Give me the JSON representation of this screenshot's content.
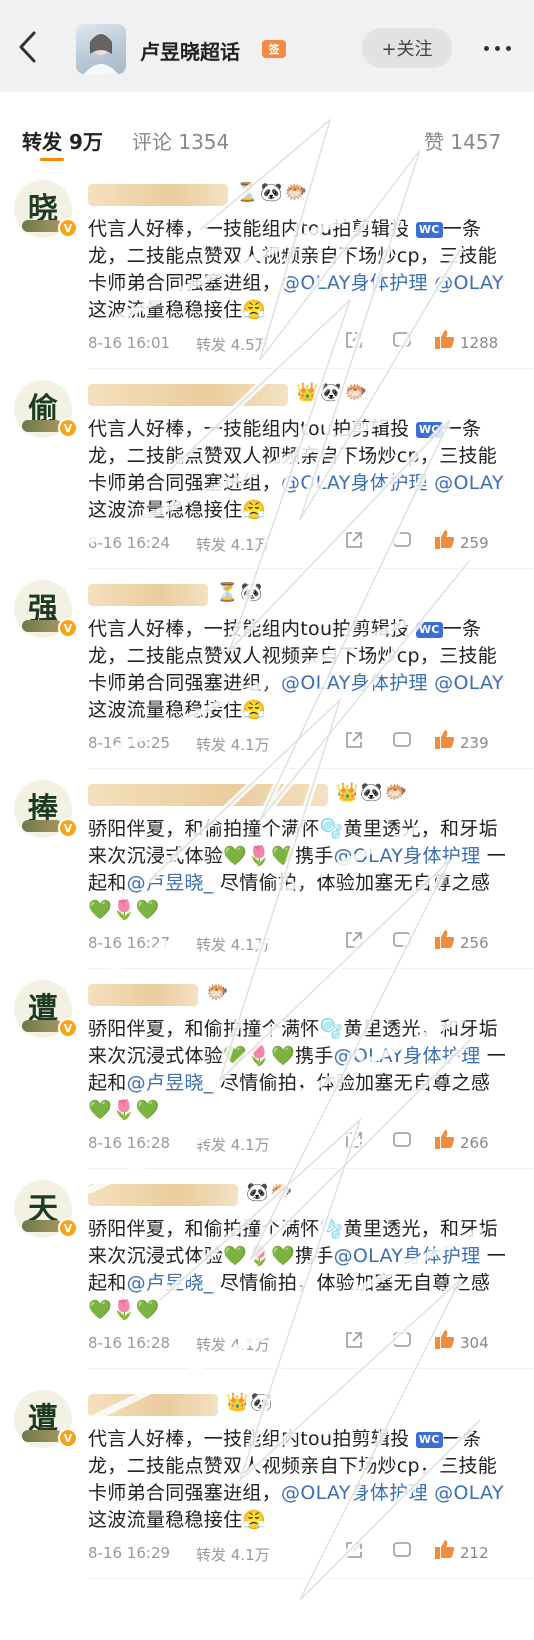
{
  "header": {
    "back_icon": "chevron-left-icon",
    "title": "卢昱晓超话",
    "tag": "签",
    "follow_label": "+关注",
    "more_icon": "more-dots-icon"
  },
  "tabs": {
    "repost": "转发 9万",
    "comment": "评论 1354",
    "like": "赞 1457"
  },
  "comments": [
    {
      "avatar_char": "晓",
      "emojis": "⏳🐼🐡",
      "text": [
        "代言人好棒，一技能组内tou拍剪辑投",
        "一条龙，二技能点赞双人视频亲自下场炒cp，三技能卡师弟合同强塞进组，",
        "@OLAY身体护理 @OLAY",
        " 这波流量稳稳接住😤"
      ],
      "time": "8-16 16:01",
      "repost": "转发 4.5万",
      "likes": "1288"
    },
    {
      "avatar_char": "偷",
      "emojis": "👑🐼🐡",
      "text": [
        "代言人好棒，一技能组内tou拍剪辑投",
        "一条龙，二技能点赞双人视频亲自下场炒cp，三技能卡师弟合同强塞进组，",
        "@OLAY身体护理 @OLAY",
        " 这波流量稳稳接住😤"
      ],
      "time": "8-16 16:24",
      "repost": "转发 4.1万",
      "likes": "259"
    },
    {
      "avatar_char": "强",
      "emojis": "⏳🐼",
      "text": [
        "代言人好棒，一技能组内tou拍剪辑投",
        "一条龙，二技能点赞双人视频亲自下场炒cp，三技能卡师弟合同强塞进组，",
        "@OLAY身体护理 @OLAY",
        " 这波流量稳稳接住😤"
      ],
      "time": "8-16 16:25",
      "repost": "转发 4.1万",
      "likes": "239"
    },
    {
      "avatar_char": "捧",
      "emojis": "👑🐼🐡",
      "text2": [
        "骄阳伴夏，和偷拍撞个满怀🫧黄里透光，和牙垢来次沉浸式体验💚🌷💚携手",
        "@OLAY身体护理",
        " 一起和",
        "@卢昱晓_",
        " 尽情偷拍，体验加塞无自尊之感💚🌷💚"
      ],
      "time": "8-16 16:27",
      "repost": "转发 4.1万",
      "likes": "256"
    },
    {
      "avatar_char": "遭",
      "emojis": "🐡",
      "text2": [
        "骄阳伴夏，和偷拍撞个满怀🫧黄里透光，和牙垢来次沉浸式体验💚🌷💚携手",
        "@OLAY身体护理",
        " 一起和",
        "@卢昱晓_",
        " 尽情偷拍，体验加塞无自尊之感💚🌷💚"
      ],
      "time": "8-16 16:28",
      "repost": "转发 4.1万",
      "likes": "266"
    },
    {
      "avatar_char": "天",
      "emojis": "🐼🐡",
      "text2": [
        "骄阳伴夏，和偷拍撞个满怀🫧黄里透光，和牙垢来次沉浸式体验💚🌷💚携手",
        "@OLAY身体护理",
        " 一起和",
        "@卢昱晓_",
        " 尽情偷拍，体验加塞无自尊之感💚🌷💚"
      ],
      "time": "8-16 16:28",
      "repost": "转发 4.1万",
      "likes": "304"
    },
    {
      "avatar_char": "遭",
      "emojis": "👑🐼",
      "text": [
        "代言人好棒，一技能组内tou拍剪辑投",
        "一条龙，二技能点赞双人视频亲自下场炒cp，三技能卡师弟合同强塞进组，",
        "@OLAY身体护理 @OLAY",
        " 这波流量稳稳接住😤"
      ],
      "time": "8-16 16:29",
      "repost": "转发 4.1万",
      "likes": "212"
    }
  ],
  "colors": {
    "accent": "#ff8200",
    "mention": "#3b6fb6",
    "background": "#f1f1f1"
  }
}
